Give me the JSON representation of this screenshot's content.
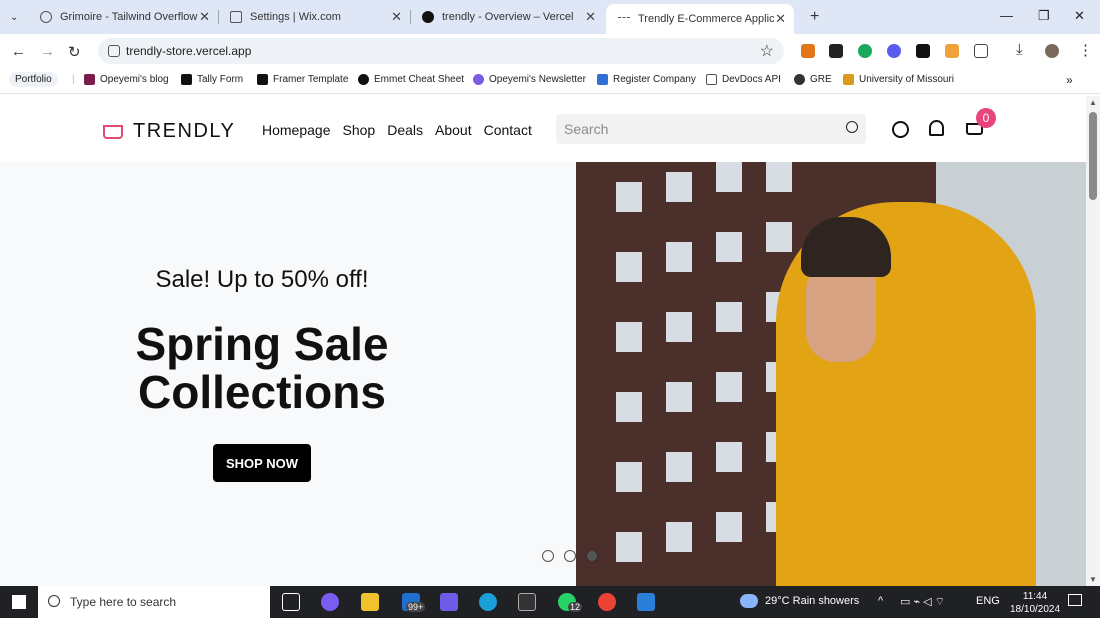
{
  "browser": {
    "tabs": [
      {
        "title": "Grimoire - Tailwind Overflow Cl",
        "active": false
      },
      {
        "title": "Settings | Wix.com",
        "active": false
      },
      {
        "title": "trendly - Overview – Vercel",
        "active": false
      },
      {
        "title": "Trendly E-Commerce Applicatio",
        "active": true
      }
    ],
    "url": "trendly-store.vercel.app",
    "bookmarks": [
      "Portfolio",
      "Opeyemi's blog",
      "Tally Form",
      "Framer Template",
      "Emmet Cheat Sheet",
      "Opeyemi's Newsletter",
      "Register Company",
      "DevDocs API",
      "GRE",
      "University of Missouri"
    ]
  },
  "site": {
    "brand": "TRENDLY",
    "nav": [
      "Homepage",
      "Shop",
      "Deals",
      "About",
      "Contact"
    ],
    "search_placeholder": "Search",
    "cart_count": "0",
    "hero": {
      "subtitle": "Sale! Up to 50% off!",
      "title_line1": "Spring Sale",
      "title_line2": "Collections",
      "cta": "SHOP NOW"
    },
    "carousel": {
      "count": 3,
      "active_index": 2
    }
  },
  "taskbar": {
    "search_placeholder": "Type here to search",
    "mail_badge": "99+",
    "whatsapp_badge": "12",
    "weather": "29°C  Rain showers",
    "lang": "ENG",
    "time": "11:44",
    "date": "18/10/2024"
  }
}
